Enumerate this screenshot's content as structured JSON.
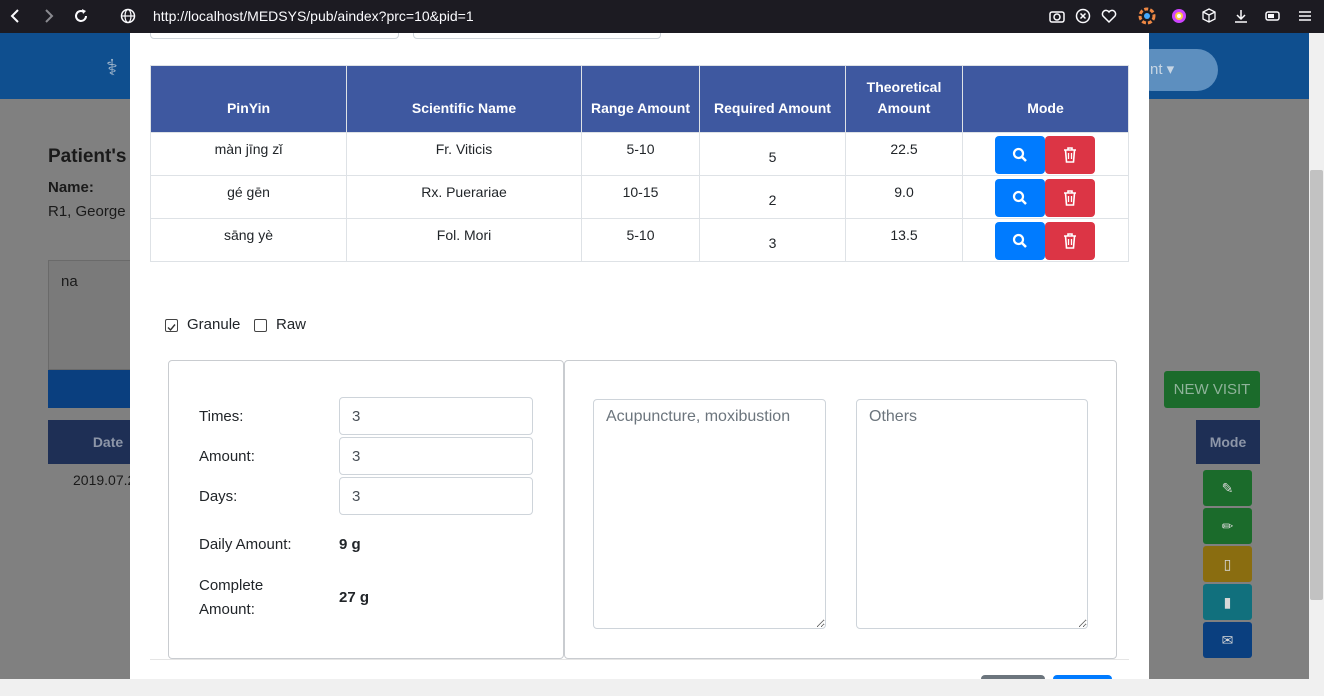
{
  "browser": {
    "url": "http://localhost/MEDSYS/pub/aindex?prc=10&pid=1",
    "back_icon": "back-arrow-icon",
    "forward_icon": "forward-arrow-icon",
    "reload_icon": "reload-icon"
  },
  "background": {
    "nav_pill": "nt",
    "patient_title": "Patient's",
    "name_label": "Name:",
    "name_value": "R1, George",
    "note_text": "na",
    "new_visit_label": "NEW VISIT",
    "date_header": "Date",
    "mode_header": "Mode",
    "date_value": "2019.07.2"
  },
  "herb_table": {
    "headers": [
      "PinYin",
      "Scientific Name",
      "Range Amount",
      "Required Amount",
      "Theoretical Amount",
      "Mode"
    ],
    "rows": [
      {
        "pinyin": "màn jīng zǐ",
        "scientific": "Fr. Viticis",
        "range": "5-10",
        "required": "5",
        "theoretical": "22.5"
      },
      {
        "pinyin": "gé gēn",
        "scientific": "Rx. Puerariae",
        "range": "10-15",
        "required": "2",
        "theoretical": "9.0"
      },
      {
        "pinyin": "sāng yè",
        "scientific": "Fol. Mori",
        "range": "5-10",
        "required": "3",
        "theoretical": "13.5"
      }
    ]
  },
  "form_type": {
    "granule_label": "Granule",
    "granule_checked": true,
    "raw_label": "Raw",
    "raw_checked": false
  },
  "dosage": {
    "times_label": "Times:",
    "times_value": "3",
    "amount_label": "Amount:",
    "amount_value": "3",
    "days_label": "Days:",
    "days_value": "3",
    "daily_amount_label": "Daily Amount:",
    "daily_amount_value": "9 g",
    "complete_amount_label_1": "Complete",
    "complete_amount_label_2": "Amount:",
    "complete_amount_value": "27 g"
  },
  "notes": {
    "acupuncture_placeholder": "Acupuncture, moxibustion",
    "others_placeholder": "Others"
  },
  "colors": {
    "table_header": "#3e58a0",
    "primary": "#007bff",
    "danger": "#dc3545"
  }
}
